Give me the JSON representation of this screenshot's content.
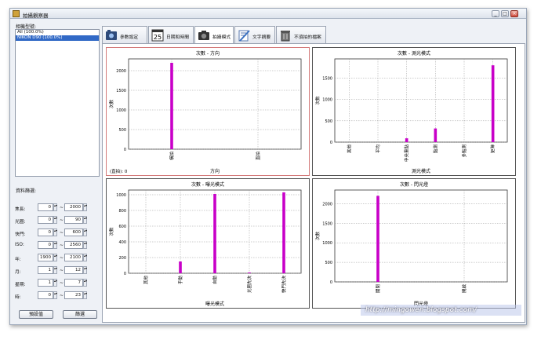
{
  "window": {
    "title": "拍攝觀察器",
    "min": "_",
    "max": "□",
    "close": "×"
  },
  "left": {
    "source_label": "相機型號:",
    "list_items": [
      "All (100.0%)",
      "NIKON D90 (100.0%)"
    ],
    "filter_label": "資料篩選:",
    "filters": [
      {
        "label": "焦長:",
        "min": "0",
        "max": "2000"
      },
      {
        "label": "光圈:",
        "min": "0",
        "max": "90"
      },
      {
        "label": "快門:",
        "min": "0",
        "max": "600"
      },
      {
        "label": "ISO:",
        "min": "0",
        "max": "2560"
      },
      {
        "label": "年:",
        "min": "1900",
        "max": "2100"
      },
      {
        "label": "月:",
        "min": "1",
        "max": "12"
      },
      {
        "label": "星期:",
        "min": "1",
        "max": "7"
      },
      {
        "label": "時:",
        "min": "0",
        "max": "23"
      }
    ],
    "tilde": "~",
    "reset_button": "預設值",
    "apply_button": "篩選"
  },
  "tabs": [
    {
      "label": "參數設定",
      "icon": "settings-icon"
    },
    {
      "label": "日期和時間",
      "icon": "calendar-icon",
      "badge": "25"
    },
    {
      "label": "拍攝模式",
      "icon": "camera-icon"
    },
    {
      "label": "文字摘要",
      "icon": "notepad-icon"
    },
    {
      "label": "不須拍的檔案",
      "icon": "trash-icon"
    }
  ],
  "watermark": "http://mingowen.blogspot.com/",
  "chart_data": [
    {
      "type": "bar",
      "title": "次數 - 方向",
      "xlabel": "方向",
      "ylabel": "次數",
      "categories": [
        "橫拍",
        "直拍"
      ],
      "values": [
        2200,
        0
      ],
      "yticks": [
        0,
        500,
        1000,
        1500,
        2000
      ],
      "ylim": [
        0,
        2300
      ],
      "annotation": "(直拍): 0",
      "color": "#c800c8",
      "grid": true
    },
    {
      "type": "bar",
      "title": "次數 - 測光模式",
      "xlabel": "測光模式",
      "ylabel": "次數",
      "categories": [
        "其他",
        "平均",
        "中央重點",
        "點測",
        "多點測",
        "矩陣"
      ],
      "values": [
        0,
        0,
        90,
        320,
        0,
        1800
      ],
      "yticks": [
        0,
        500,
        1000,
        1500
      ],
      "ylim": [
        0,
        1950
      ],
      "color": "#c800c8",
      "grid": true
    },
    {
      "type": "bar",
      "title": "次數 - 曝光模式",
      "xlabel": "曝光模式",
      "ylabel": "次數",
      "categories": [
        "其他",
        "手動",
        "自動",
        "光圈先決",
        "快門先決"
      ],
      "values": [
        0,
        150,
        1010,
        10,
        1030
      ],
      "yticks": [
        0,
        200,
        400,
        600,
        800,
        1000
      ],
      "ylim": [
        0,
        1060
      ],
      "color": "#c800c8",
      "grid": true
    },
    {
      "type": "bar",
      "title": "次數 - 閃光燈",
      "xlabel": "閃光燈",
      "ylabel": "次數",
      "categories": [
        "關閉",
        "開啟"
      ],
      "values": [
        2200,
        0
      ],
      "yticks": [
        0,
        500,
        1000,
        1500,
        2000
      ],
      "ylim": [
        0,
        2350
      ],
      "color": "#c800c8",
      "grid": true
    }
  ]
}
